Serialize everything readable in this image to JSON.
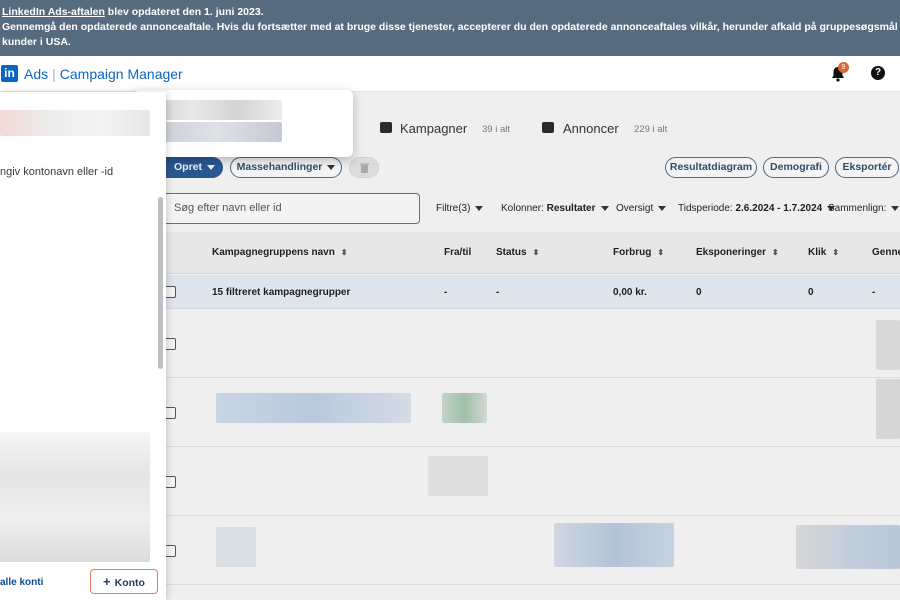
{
  "banner": {
    "link_text": "LinkedIn Ads-aftalen",
    "line1_rest": " blev opdateret den 1. juni 2023.",
    "line2": "Gennemgå den opdaterede annonceaftale. Hvis du fortsætter med at bruge disse tjenester, accepterer du den opdaterede annonceaftales vilkår, herunder afkald på gruppesøgsmål og en standardaftale for",
    "line3": "kunder i USA."
  },
  "header": {
    "logo": "in",
    "brand_ads": "Ads",
    "brand_separator": "|",
    "brand_name": "Campaign Manager",
    "notification_count": "9",
    "help_symbol": "?"
  },
  "tabs": [
    {
      "label": "Kampagner",
      "count": "39 i alt"
    },
    {
      "label": "Annoncer",
      "count": "229 i alt"
    }
  ],
  "toolbar": {
    "create": "Opret",
    "bulk": "Massehandlinger",
    "results_chart": "Resultatdiagram",
    "demographics": "Demografi",
    "export": "Eksportér"
  },
  "search": {
    "placeholder": "Søg efter navn eller id"
  },
  "filters": {
    "filters_label": "Filtre(3)",
    "columns_label": "Kolonner:",
    "columns_value": "Resultater",
    "overview_label": "Oversigt",
    "period_label": "Tidsperiode:",
    "period_value": "2.6.2024 - 1.7.2024",
    "compare_label": "Sammenlign:"
  },
  "table": {
    "headers": [
      "Kampagnegruppens navn",
      "Fra/til",
      "Status",
      "Forbrug",
      "Eksponeringer",
      "Klik",
      "Genne"
    ],
    "summary": [
      "15 filtreret kampagnegrupper",
      "-",
      "-",
      "0,00 kr.",
      "0",
      "0",
      "-"
    ]
  },
  "drawer": {
    "search_hint": "ngiv kontonavn eller -id",
    "all_accounts": "alle konti",
    "add_account": "Konto",
    "add_symbol": "+"
  },
  "colors": {
    "brand_blue": "#0a66c2",
    "banner_bg": "#566b7e",
    "badge": "#e06638"
  }
}
